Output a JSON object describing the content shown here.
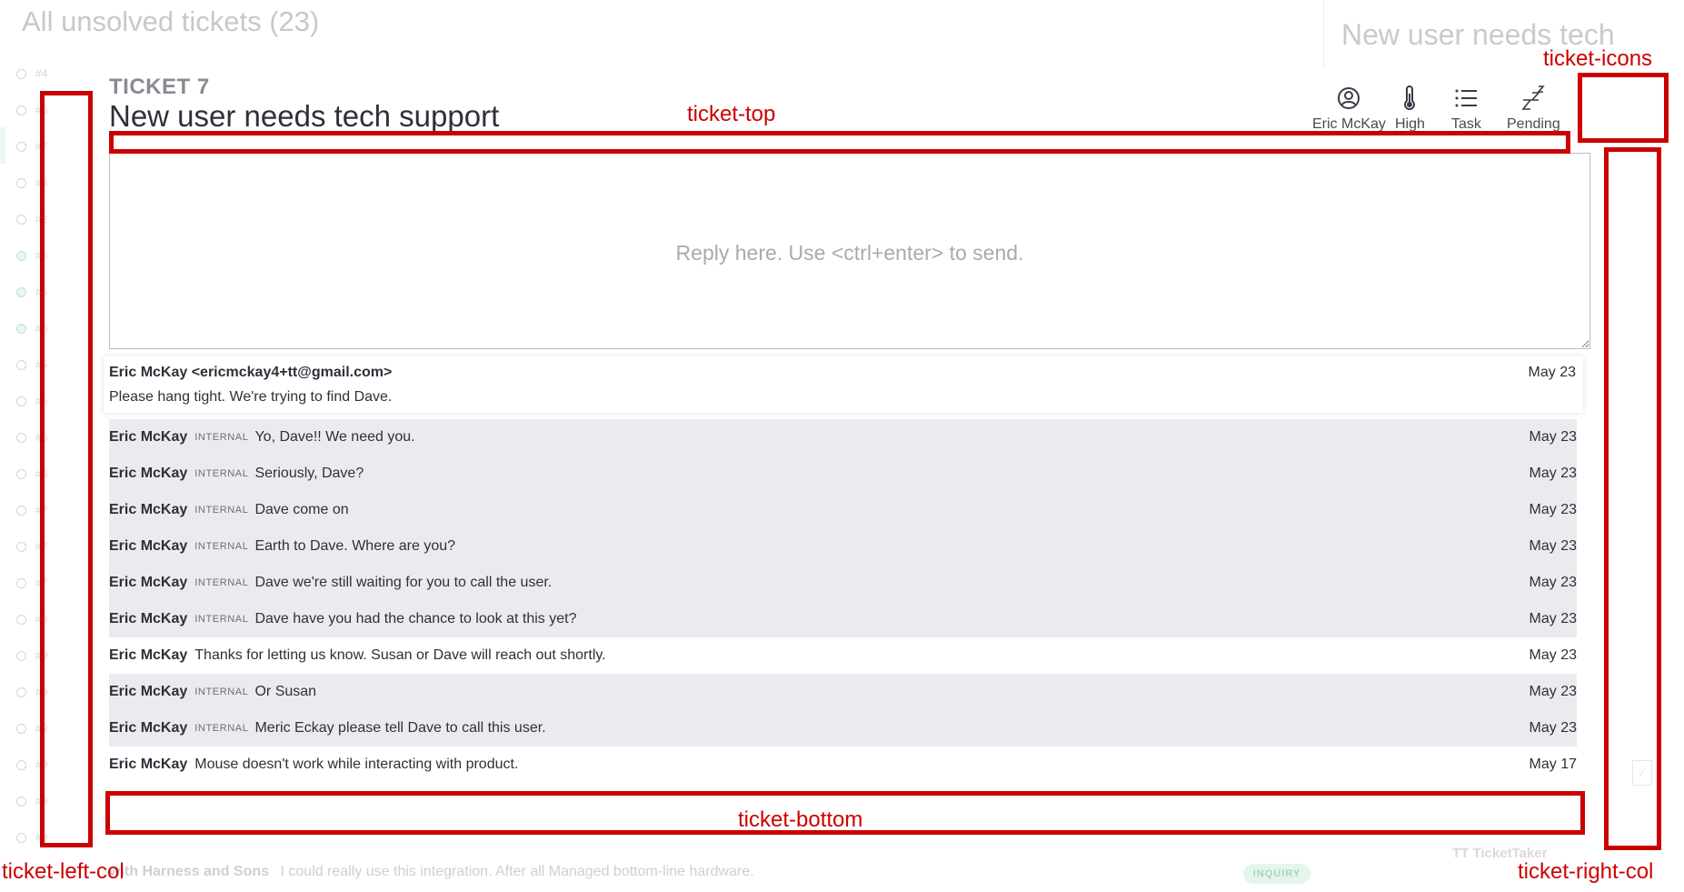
{
  "background": {
    "list_title": "All unsolved tickets (23)",
    "list_items": [
      {
        "num": "#4",
        "green": false
      },
      {
        "num": "#6",
        "green": false
      },
      {
        "num": "#7",
        "green": false
      },
      {
        "num": "#8",
        "green": false
      },
      {
        "num": "#2",
        "green": false
      },
      {
        "num": "#5",
        "green": true
      },
      {
        "num": "#5",
        "green": true
      },
      {
        "num": "#5",
        "green": true
      },
      {
        "num": "#5",
        "green": false
      },
      {
        "num": "#5",
        "green": false
      },
      {
        "num": "#6",
        "green": false
      },
      {
        "num": "#6",
        "green": false
      },
      {
        "num": "#7",
        "green": false
      },
      {
        "num": "#7",
        "green": false
      },
      {
        "num": "#7",
        "green": false
      },
      {
        "num": "#8",
        "green": false
      },
      {
        "num": "#9",
        "green": false
      },
      {
        "num": "#9",
        "green": false
      },
      {
        "num": "#9",
        "green": false
      },
      {
        "num": "#9",
        "green": false
      },
      {
        "num": "#9",
        "green": false
      },
      {
        "num": "#9",
        "green": false
      }
    ],
    "right_title": "New user needs tech",
    "footer_subject": "with Harness and Sons",
    "footer_preview": "I could really use this integration. After all Managed bottom-line hardware.",
    "footer_badge": "INQUIRY",
    "brand": "TT TicketTaker"
  },
  "ticket": {
    "number_label": "TICKET 7",
    "title": "New user needs tech support",
    "meta": {
      "assignee": "Eric McKay",
      "priority": "High",
      "type": "Task",
      "status": "Pending"
    },
    "reply_placeholder": "Reply here. Use <ctrl+enter> to send.",
    "first_message": {
      "from": "Eric McKay <ericmckay4+tt@gmail.com>",
      "date": "May 23",
      "body": "Please hang tight. We're trying to find Dave."
    },
    "internal_tag": "INTERNAL",
    "messages": [
      {
        "author": "Eric McKay",
        "internal": true,
        "text": "Yo, Dave!! We need you.",
        "date": "May 23"
      },
      {
        "author": "Eric McKay",
        "internal": true,
        "text": "Seriously, Dave?",
        "date": "May 23"
      },
      {
        "author": "Eric McKay",
        "internal": true,
        "text": "Dave come on",
        "date": "May 23"
      },
      {
        "author": "Eric McKay",
        "internal": true,
        "text": "Earth to Dave. Where are you?",
        "date": "May 23"
      },
      {
        "author": "Eric McKay",
        "internal": true,
        "text": "Dave we're still waiting for you to call the user.",
        "date": "May 23"
      },
      {
        "author": "Eric McKay",
        "internal": true,
        "text": "Dave have you had the chance to look at this yet?",
        "date": "May 23"
      },
      {
        "author": "Eric McKay",
        "internal": false,
        "text": "Thanks for letting us know. Susan or Dave will reach out shortly.",
        "date": "May 23"
      },
      {
        "author": "Eric McKay",
        "internal": true,
        "text": "Or Susan",
        "date": "May 23"
      },
      {
        "author": "Eric McKay",
        "internal": true,
        "text": "Meric Eckay please tell Dave to call this user.",
        "date": "May 23"
      },
      {
        "author": "Eric McKay",
        "internal": false,
        "text": "Mouse doesn't work while interacting with product.",
        "date": "May 17"
      }
    ]
  },
  "annotations": {
    "ticket_top": "ticket-top",
    "ticket_icons": "ticket-icons",
    "ticket_bottom": "ticket-bottom",
    "ticket_left_col": "ticket-left-col",
    "ticket_right_col": "ticket-right-col",
    "color": "#cc0000"
  }
}
